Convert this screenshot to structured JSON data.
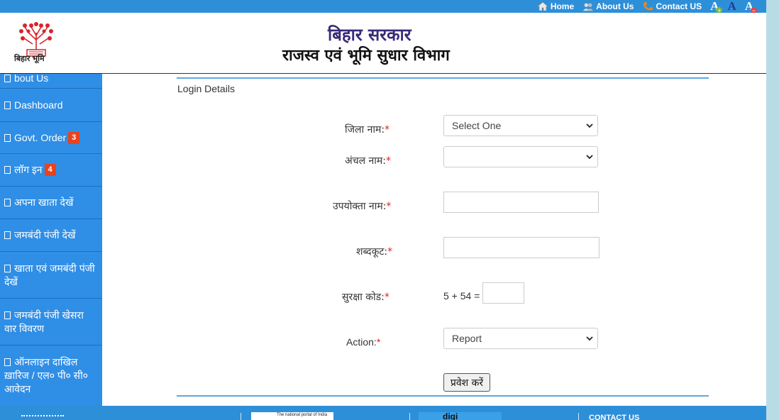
{
  "topnav": {
    "home": "Home",
    "about": "About Us",
    "contact": "Contact US",
    "font_increase": "A",
    "font_normal": "A",
    "font_decrease": "A"
  },
  "header": {
    "logo_caption": "बिहार भूमि",
    "title_line1": "बिहार सरकार",
    "title_line2": "राजस्व एवं भूमि सुधार विभाग"
  },
  "sidebar": {
    "items": [
      {
        "label": "bout Us"
      },
      {
        "label": "Dashboard"
      },
      {
        "label": "Govt. Order",
        "badge": "3"
      },
      {
        "label": "लॉग इन",
        "badge": "4"
      },
      {
        "label": "अपना खाता देखें"
      },
      {
        "label": "जमबंदी पंजी देखें"
      },
      {
        "label": "खाता एवं जमबंदी पंजी देखें"
      },
      {
        "label": "जमबंदी पंजी खेसरा वार विवरण"
      },
      {
        "label": "ऑनलाइन दाखिल ख़ारिज / एल० पी० सी० आवेदन"
      }
    ]
  },
  "form": {
    "section_title": "Login Details",
    "district_label": "जिला नाम:",
    "district_value": "Select One",
    "circle_label": "अंचल नाम:",
    "circle_value": "",
    "username_label": "उपयोक्ता नाम:",
    "username_value": "",
    "password_label": "शब्दकूट:",
    "password_value": "",
    "captcha_label": "सुरक्षा कोड:",
    "captcha_question": "5 + 54 =",
    "captcha_value": "",
    "action_label": "Action:",
    "action_value": "Report",
    "required_mark": "*",
    "submit_label": "प्रवेश करें"
  },
  "footer": {
    "portal_text": "The national portal of India",
    "digi_text": "digi",
    "contact_heading": "CONTACT US"
  },
  "colors": {
    "primary_blue": "#2e8fd9",
    "sidebar_blue": "#2f8ee6",
    "badge_red": "#e8421e",
    "title_purple": "#3a2a78"
  }
}
